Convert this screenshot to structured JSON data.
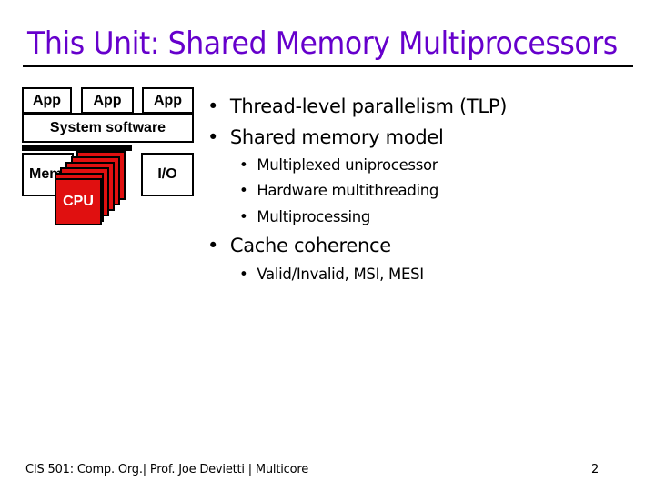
{
  "slide": {
    "title": "This Unit: Shared Memory Multiprocessors",
    "title_color": "#6600cc",
    "page_number": "2"
  },
  "diagram": {
    "apps": [
      "App",
      "App",
      "App"
    ],
    "system_software": "System software",
    "memory": "Mem",
    "io": "I/O",
    "cpu": "CPU",
    "cpu_color": "#e01010"
  },
  "bullets": [
    {
      "level": 1,
      "text": "Thread-level parallelism (TLP)"
    },
    {
      "level": 1,
      "text": "Shared memory model"
    },
    {
      "level": 2,
      "text": "Multiplexed uniprocessor"
    },
    {
      "level": 2,
      "text": "Hardware multithreading"
    },
    {
      "level": 2,
      "text": "Multiprocessing"
    },
    {
      "level": 1,
      "text": "Cache coherence"
    },
    {
      "level": 2,
      "text": "Valid/Invalid, MSI, MESI"
    }
  ],
  "bullet_glyph": "•",
  "footer": {
    "text": "CIS 501: Comp. Org.|  Prof. Joe Devietti  |  Multicore"
  }
}
